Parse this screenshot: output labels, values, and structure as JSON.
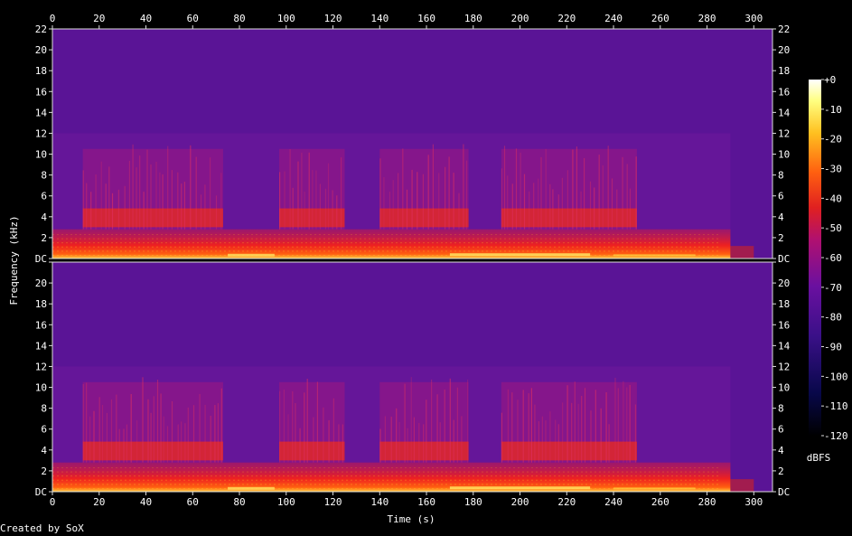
{
  "chart_data": {
    "type": "heatmap",
    "xlabel": "Time (s)",
    "ylabel": "Frequency (kHz)",
    "x_ticks": [
      0,
      20,
      40,
      60,
      80,
      100,
      120,
      140,
      160,
      180,
      200,
      220,
      240,
      260,
      280,
      300
    ],
    "xlim": [
      0,
      308
    ],
    "y_ticks": [
      "DC",
      "2",
      "4",
      "6",
      "8",
      "10",
      "12",
      "14",
      "16",
      "18",
      "20",
      "22"
    ],
    "ylim_khz": [
      0,
      22
    ],
    "channels": 2,
    "active_segments_s": [
      [
        13,
        73
      ],
      [
        97,
        125
      ],
      [
        140,
        178
      ],
      [
        192,
        250
      ]
    ],
    "signal_end_s": 290,
    "colorbar": {
      "label": "dBFS",
      "ticks": [
        "+0",
        "-10",
        "-20",
        "-30",
        "-40",
        "-50",
        "-60",
        "-70",
        "-80",
        "-90",
        "-100",
        "-110",
        "-120"
      ],
      "range_db": [
        -120,
        0
      ]
    }
  },
  "footer": {
    "credit": "Created by SoX"
  }
}
